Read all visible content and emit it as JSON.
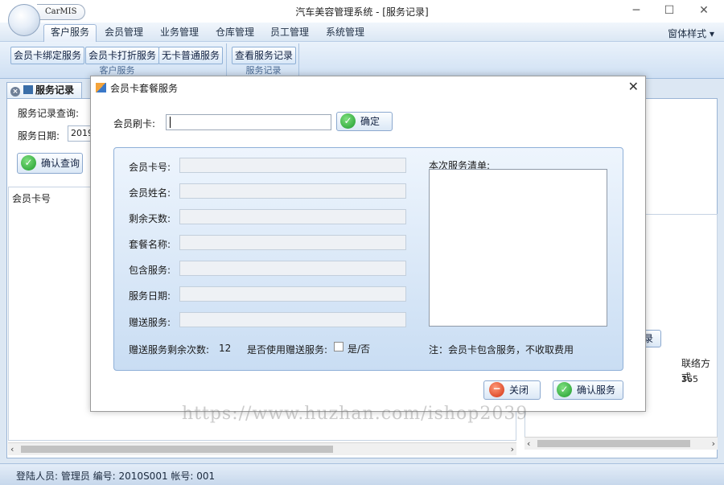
{
  "app": {
    "name": "CarMIS",
    "window_title": "汽车美容管理系统 - [服务记录]",
    "minimize_glyph": "─",
    "maximize_glyph": "☐",
    "close_glyph": "✕"
  },
  "menu": {
    "items": [
      "客户服务",
      "会员管理",
      "业务管理",
      "仓库管理",
      "员工管理",
      "系统管理"
    ],
    "active_index": 0,
    "right": "窗体样式 ▾"
  },
  "ribbon": {
    "groups": [
      {
        "label": "客户服务",
        "buttons": [
          "会员卡绑定服务",
          "会员卡打折服务",
          "无卡普通服务"
        ]
      },
      {
        "label": "服务记录",
        "buttons": [
          "查看服务记录"
        ]
      }
    ]
  },
  "background": {
    "tab_title": "服务记录",
    "query_label": "服务记录查询:",
    "date_label": "服务日期:",
    "date_value": "2019",
    "query_button": "确认查询",
    "grid_header": "会员卡号",
    "right_button": "录",
    "right_header": "联络方式",
    "right_value": "365"
  },
  "dialog": {
    "title": "会员卡套餐服务",
    "card_label": "会员刷卡:",
    "confirm_button": "确定",
    "fields": [
      "会员卡号:",
      "会员姓名:",
      "剩余天数:",
      "套餐名称:",
      "包含服务:",
      "服务日期:",
      "赠送服务:"
    ],
    "list_title": "本次服务清单:",
    "gift_remaining_label": "赠送服务剩余次数:",
    "gift_remaining_value": "12",
    "use_gift_label": "是否使用赠送服务:",
    "use_gift_option": "是/否",
    "note": "注：会员卡包含服务，不收取费用",
    "close_button": "关闭",
    "confirm_service_button": "确认服务"
  },
  "status": {
    "text": "登陆人员: 管理员  编号: 2010S001  帐号: 001"
  },
  "watermark": "https://www.huzhan.com/ishop2039",
  "colors": {
    "ribbon": "#cfe0f3",
    "panel": "#c9ddf3",
    "accent": "#3a78c8"
  }
}
